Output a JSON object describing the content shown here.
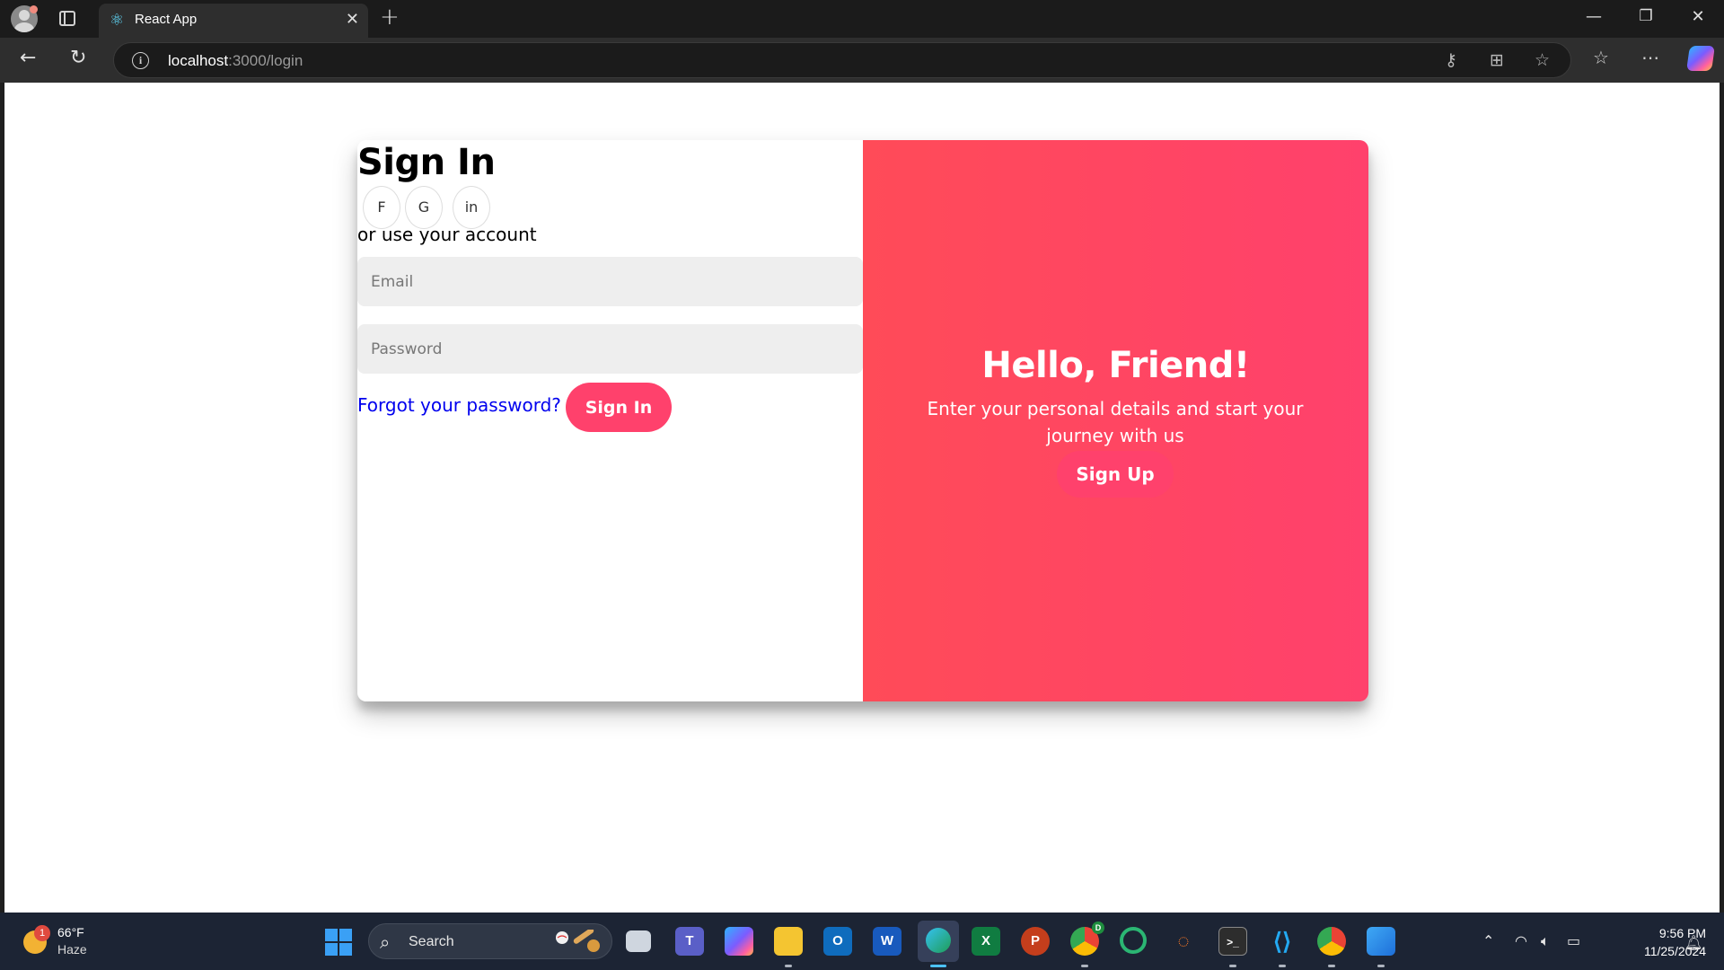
{
  "browser": {
    "tab_title": "React App",
    "url_host": "localhost",
    "url_path": ":3000/login",
    "icons": [
      "profile-icon",
      "tab-actions-icon",
      "react-favicon-icon",
      "close-icon",
      "new-tab-icon",
      "minimize-icon",
      "restore-icon",
      "window-close-icon",
      "back-icon",
      "refresh-icon",
      "site-info-icon",
      "key-icon",
      "apps-icon",
      "favorite-star-icon",
      "favorites-icon",
      "more-icon",
      "copilot-icon"
    ]
  },
  "page": {
    "signin_title": "Sign In",
    "social": [
      {
        "label": "F"
      },
      {
        "label": "G"
      },
      {
        "label": "in"
      }
    ],
    "alt_text": "or use your account",
    "email_placeholder": "Email",
    "password_placeholder": "Password",
    "forgot_link": "Forgot your password?",
    "signin_button": "Sign In",
    "overlay": {
      "title": "Hello, Friend!",
      "text": "Enter your personal details and start your journey with us",
      "signup_button": "Sign Up"
    },
    "colors": {
      "accent": "#ff416c",
      "gradient_start": "#ff4b58",
      "link": "#0000ee",
      "input_bg": "#eeeeee"
    }
  },
  "taskbar": {
    "weather_badge": "1",
    "weather_temp": "66°F",
    "weather_condition": "Haze",
    "search_label": "Search",
    "apps": [
      {
        "name": "task-view",
        "glyph": ""
      },
      {
        "name": "teams",
        "glyph": "T"
      },
      {
        "name": "copilot",
        "glyph": ""
      },
      {
        "name": "file-explorer",
        "glyph": ""
      },
      {
        "name": "outlook",
        "glyph": "O"
      },
      {
        "name": "word",
        "glyph": "W"
      },
      {
        "name": "edge",
        "glyph": ""
      },
      {
        "name": "excel",
        "glyph": "X"
      },
      {
        "name": "powerpoint",
        "glyph": "P"
      },
      {
        "name": "chrome-profile-d",
        "glyph": ""
      },
      {
        "name": "chrome-canary",
        "glyph": ""
      },
      {
        "name": "jupyter",
        "glyph": ""
      },
      {
        "name": "terminal",
        "glyph": ">_"
      },
      {
        "name": "vscode",
        "glyph": ""
      },
      {
        "name": "chrome",
        "glyph": ""
      },
      {
        "name": "paint",
        "glyph": ""
      }
    ],
    "chrome_profile_badge": "D",
    "clock_time": "9:56 PM",
    "clock_date": "11/25/2024"
  }
}
